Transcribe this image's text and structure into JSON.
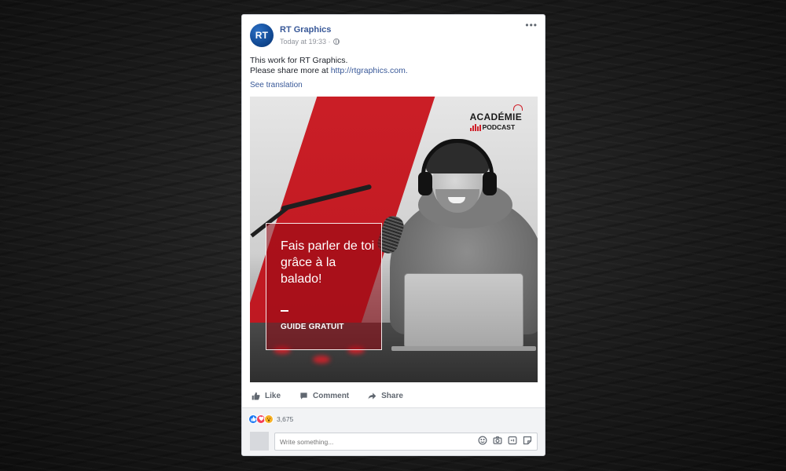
{
  "post": {
    "avatar_text": "RT",
    "page_name": "RT Graphics",
    "timestamp": "Today at 19:33 ·",
    "more_label": "•••",
    "text_line1": "This work for RT Graphics.",
    "text_line2_prefix": "Please share more at ",
    "link_text": "http://rtgraphics.com.",
    "see_translation": "See translation"
  },
  "media": {
    "brand_top": "ACADÉMIE",
    "brand_bottom": "PODCAST",
    "headline": "Fais parler de toi grâce à la balado!",
    "dash": "—",
    "cta": "GUIDE GRATUIT",
    "accent_color": "#c8192a"
  },
  "actions": {
    "like_label": "Like",
    "comment_label": "Comment",
    "share_label": "Share"
  },
  "reactions": {
    "count": "3,675",
    "types": [
      "like-icon",
      "love-icon",
      "wow-icon"
    ]
  },
  "comment_box": {
    "placeholder": "Write something...",
    "icons": [
      "emoji-icon",
      "camera-icon",
      "gif-icon",
      "sticker-icon"
    ]
  }
}
